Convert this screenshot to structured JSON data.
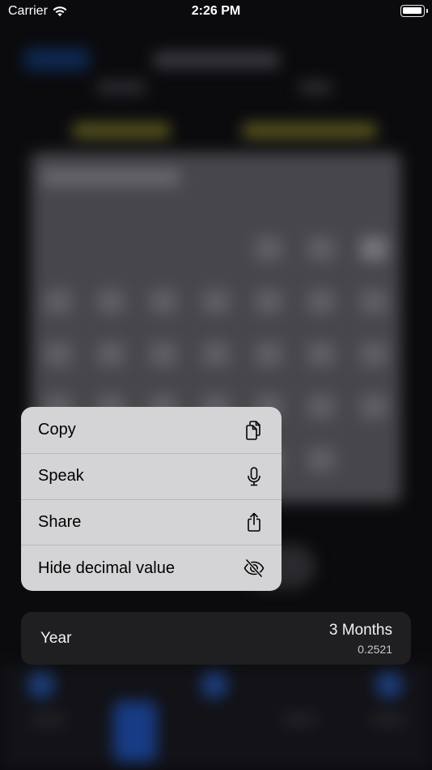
{
  "status_bar": {
    "carrier": "Carrier",
    "time": "2:26 PM"
  },
  "context_menu": {
    "items": [
      {
        "label": "Copy",
        "icon": "copy-icon"
      },
      {
        "label": "Speak",
        "icon": "microphone-icon"
      },
      {
        "label": "Share",
        "icon": "share-icon"
      },
      {
        "label": "Hide decimal value",
        "icon": "eye-slash-icon"
      }
    ]
  },
  "result": {
    "label": "Year",
    "primary_value": "3 Months",
    "secondary_value": "0.2521"
  },
  "colors": {
    "menu_background": "#d4d4d6",
    "card_background": "#1f1f21",
    "page_background": "#0b0b0e"
  }
}
